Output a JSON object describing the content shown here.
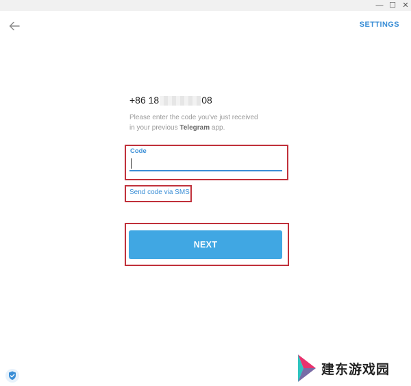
{
  "window": {
    "controls": {
      "minimize": "—",
      "maximize": "☐",
      "close": "✕"
    }
  },
  "header": {
    "settings_label": "SETTINGS"
  },
  "login": {
    "phone_prefix": "+86 18",
    "phone_suffix": "08",
    "description_line1": "Please enter the code you've just received",
    "description_line2_before": "in your previous ",
    "description_app": "Telegram",
    "description_line2_after": " app.",
    "code_label": "Code",
    "code_value": "",
    "sms_link": "Send code via SMS",
    "next_label": "NEXT"
  },
  "watermark": {
    "text": "建东游戏园"
  },
  "colors": {
    "accent": "#3a8ed6",
    "button": "#40a7e3",
    "highlight": "#c0303a"
  }
}
